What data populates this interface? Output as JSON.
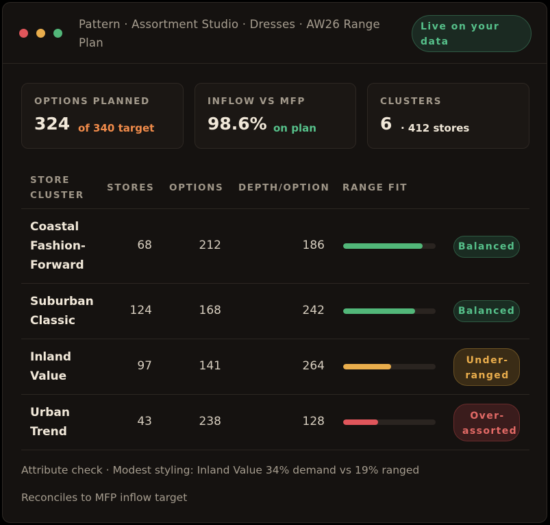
{
  "window": {
    "title": "Pattern · Assortment Studio · Dresses · AW26 Range Plan",
    "live_badge": "Live on your data"
  },
  "colors": {
    "green": "#52b779",
    "amber": "#e9ad4c",
    "red": "#e0565b",
    "orange_note": "#f08b4a"
  },
  "kpis": {
    "options": {
      "label": "OPTIONS PLANNED",
      "value": "324",
      "note": "of 340 target"
    },
    "inflow": {
      "label": "INFLOW VS MFP",
      "value": "98.6%",
      "note": "on plan"
    },
    "clusters": {
      "label": "CLUSTERS",
      "value": "6",
      "note": "· 412 stores"
    }
  },
  "table": {
    "headers": {
      "cluster": "STORE CLUSTER",
      "stores": "STORES",
      "options": "OPTIONS",
      "depth": "DEPTH/OPTION",
      "fit": "RANGE FIT"
    },
    "rows": [
      {
        "name": "Coastal Fashion-Forward",
        "stores": "68",
        "options": "212",
        "depth": "186",
        "fit": 0.86,
        "fit_color": "green",
        "status": "Balanced",
        "status_kind": "balanced"
      },
      {
        "name": "Suburban Classic",
        "stores": "124",
        "options": "168",
        "depth": "242",
        "fit": 0.78,
        "fit_color": "green",
        "status": "Balanced",
        "status_kind": "balanced"
      },
      {
        "name": "Inland Value",
        "stores": "97",
        "options": "141",
        "depth": "264",
        "fit": 0.52,
        "fit_color": "amber",
        "status": "Under-ranged",
        "status_kind": "under"
      },
      {
        "name": "Urban Trend",
        "stores": "43",
        "options": "238",
        "depth": "128",
        "fit": 0.38,
        "fit_color": "red",
        "status": "Over-assorted",
        "status_kind": "over"
      }
    ]
  },
  "footer": {
    "attribute_check": "Attribute check · Modest styling: Inland Value 34% demand vs 19% ranged",
    "reconcile": "Reconciles to MFP inflow target"
  }
}
